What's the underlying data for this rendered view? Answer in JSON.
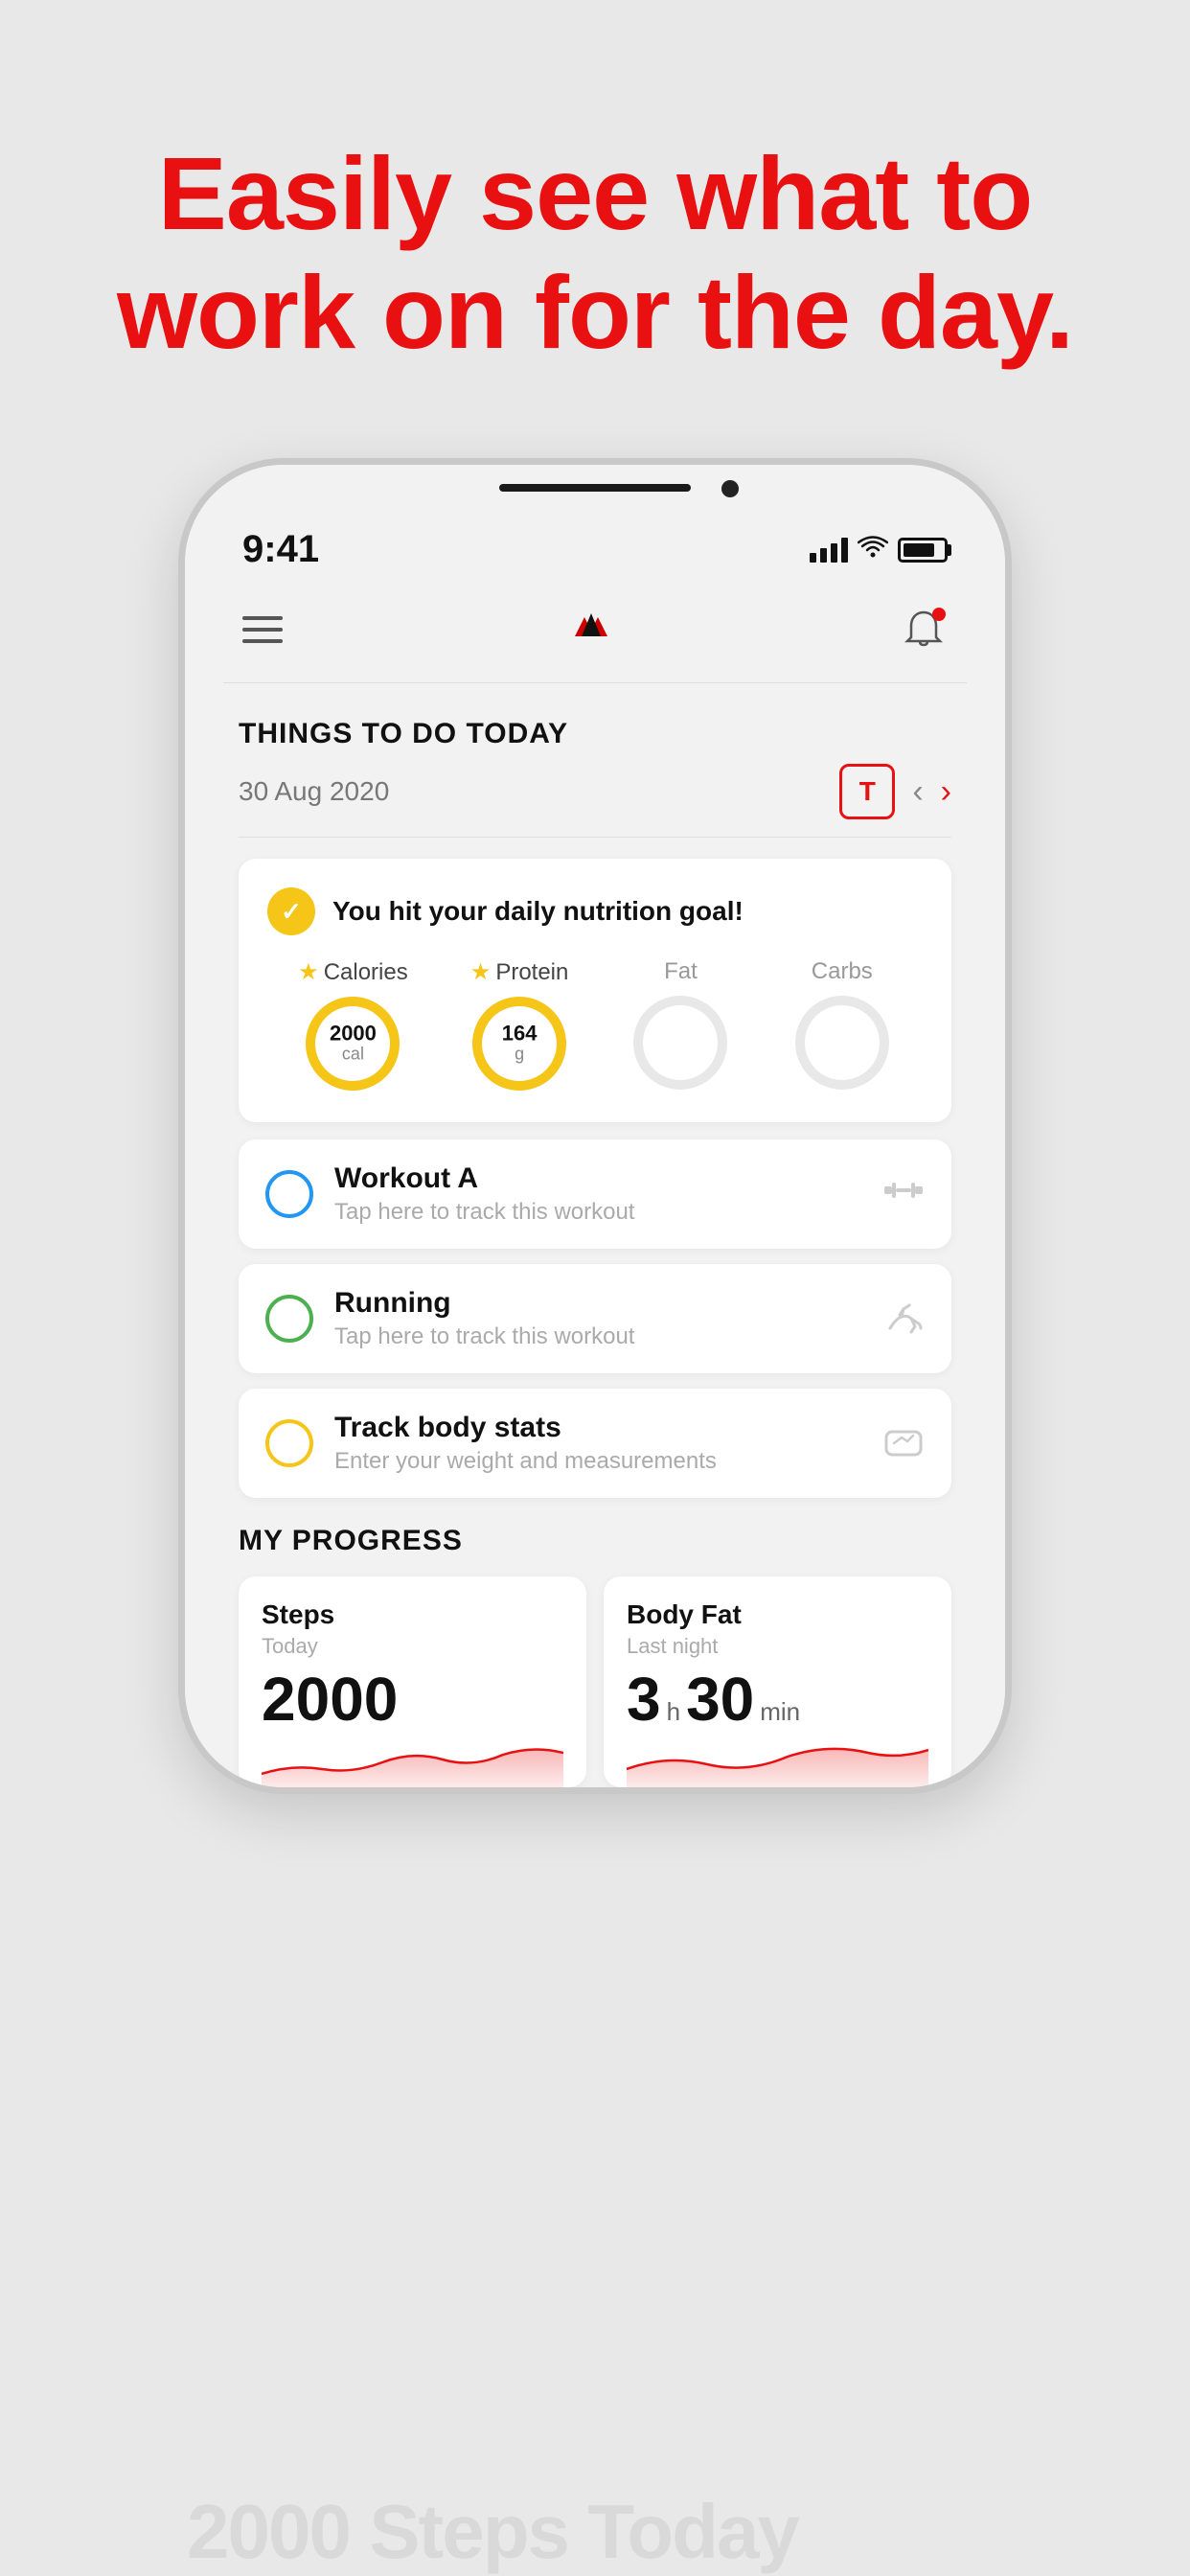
{
  "background_color": "#e8e8e8",
  "hero": {
    "text_line1": "Easily see what to",
    "text_line2": "work on for the day.",
    "color": "#e81010"
  },
  "phone": {
    "status_bar": {
      "time": "9:41",
      "signal": "●●●●",
      "wifi": "wifi",
      "battery": "battery"
    },
    "header": {
      "menu_label": "menu",
      "logo_alt": "app logo",
      "bell_label": "notifications"
    },
    "section_title": "THINGS TO DO TODAY",
    "date": "30 Aug 2020",
    "today_button": "T",
    "nutrition": {
      "goal_text": "You hit your daily nutrition goal!",
      "macros": [
        {
          "name": "Calories",
          "starred": true,
          "value": "2000",
          "unit": "cal",
          "progress": 1.0,
          "color": "#f5c518"
        },
        {
          "name": "Protein",
          "starred": true,
          "value": "164",
          "unit": "g",
          "progress": 1.0,
          "color": "#f5c518"
        },
        {
          "name": "Fat",
          "starred": false,
          "value": "",
          "unit": "",
          "progress": 0,
          "color": "#e0e0e0"
        },
        {
          "name": "Carbs",
          "starred": false,
          "value": "",
          "unit": "",
          "progress": 0,
          "color": "#e0e0e0"
        }
      ]
    },
    "tasks": [
      {
        "name": "Workout A",
        "subtitle": "Tap here to track this workout",
        "circle_color": "blue",
        "icon": "🏋"
      },
      {
        "name": "Running",
        "subtitle": "Tap here to track this workout",
        "circle_color": "green",
        "icon": "👟"
      },
      {
        "name": "Track body stats",
        "subtitle": "Enter your weight and measurements",
        "circle_color": "yellow",
        "icon": "⚖"
      }
    ],
    "progress_section": {
      "title": "MY PROGRESS",
      "cards": [
        {
          "label": "Steps",
          "sublabel": "Today",
          "value": "2000",
          "value_type": "number"
        },
        {
          "label": "Body Fat",
          "sublabel": "Last night",
          "value_h": "3",
          "value_min": "30",
          "value_type": "time"
        }
      ]
    }
  }
}
